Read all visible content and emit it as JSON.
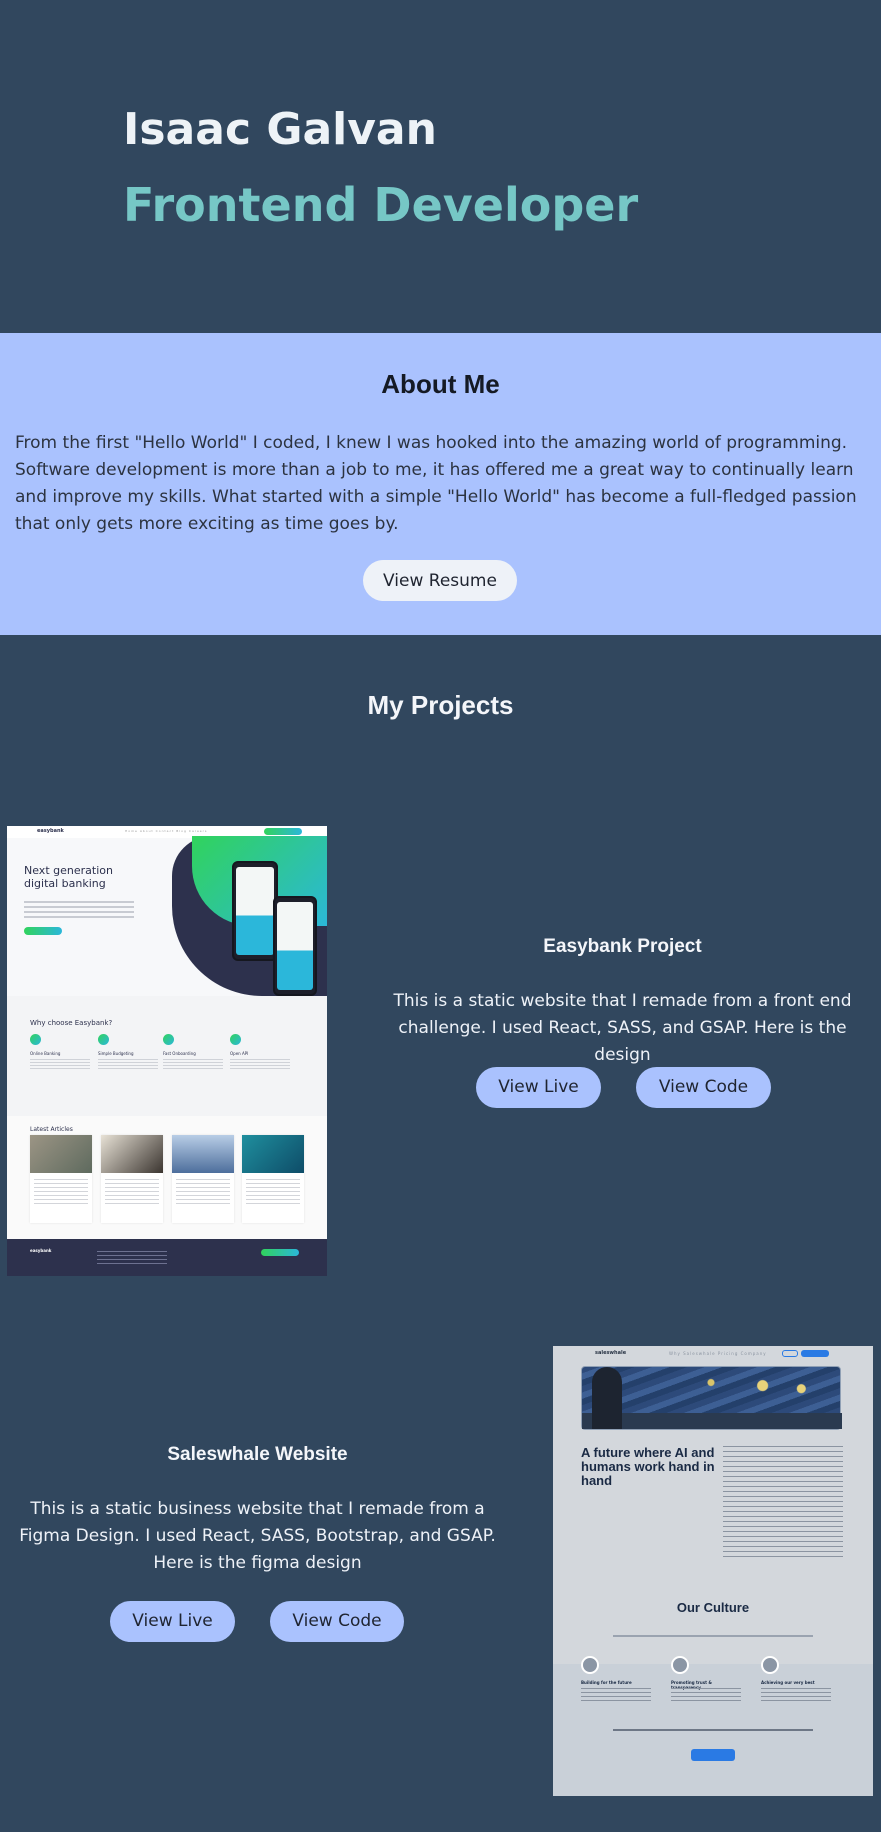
{
  "hero": {
    "name": "Isaac Galvan",
    "role": "Frontend Developer"
  },
  "about": {
    "title": "About Me",
    "text": "From the first \"Hello World\" I coded, I knew I was hooked into the amazing world of programming. Software development is more than a job to me, it has offered me a great way to continually learn and improve my skills. What started with a simple \"Hello World\" has become a full-fledged passion that only gets more exciting as time goes by.",
    "resume_label": "View Resume"
  },
  "projects": {
    "title": "My Projects",
    "items": [
      {
        "title": "Easybank Project",
        "description": "This is a static website that I remade from a front end challenge. I used React, SASS, and GSAP. Here is the design",
        "live_label": "View Live",
        "code_label": "View Code",
        "thumbnail": {
          "logo": "easybank",
          "nav": "Home  About  Contact  Blog  Careers",
          "headline": "Next generation digital banking",
          "section_title": "Why choose Easybank?",
          "features": [
            "Online Banking",
            "Simple Budgeting",
            "Fast Onboarding",
            "Open API"
          ],
          "articles_title": "Latest Articles",
          "footer_logo": "easybank"
        }
      },
      {
        "title": "Saleswhale Website",
        "description": "This is a static business website that I remade from a Figma Design. I used React, SASS, Bootstrap, and GSAP. Here is the figma design",
        "live_label": "View Live",
        "code_label": "View Code",
        "thumbnail": {
          "logo": "saleswhale",
          "nav": "Why Saleswhale  Pricing  Company",
          "headline": "A future where AI and humans work hand in hand",
          "culture_title": "Our Culture",
          "values": [
            "Building for the future",
            "Promoting trust & transparency",
            "Achieving our very best"
          ]
        }
      }
    ]
  },
  "colors": {
    "background": "#31475e",
    "about_bg": "#aac2fe",
    "accent": "#76c7c6",
    "button": "#aac2fe"
  }
}
